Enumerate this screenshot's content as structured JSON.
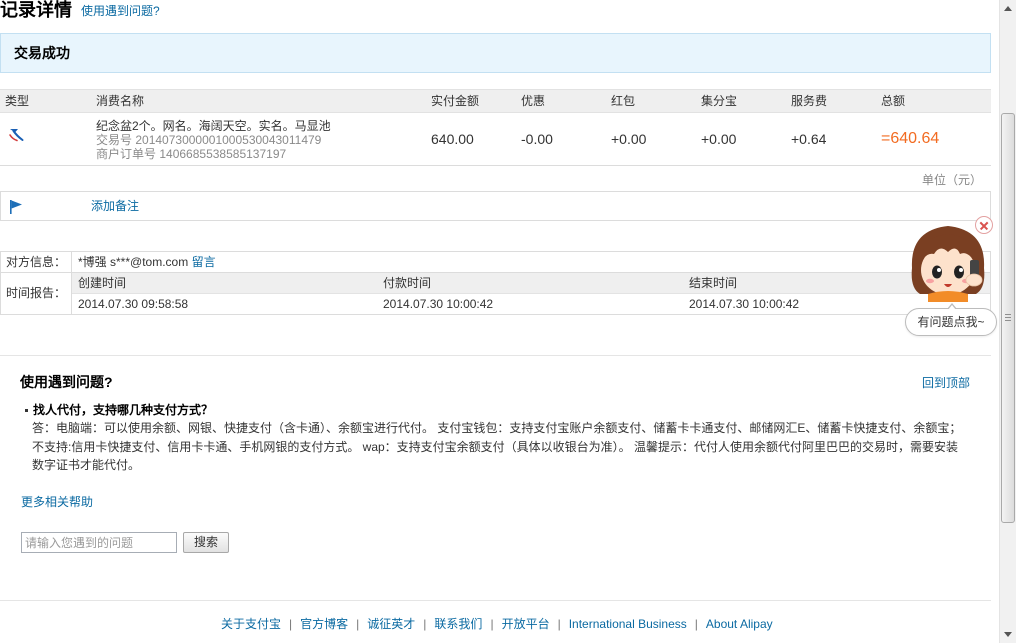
{
  "colors": {
    "link": "#0b6aa2",
    "total": "#f26b21",
    "status_bg": "#e8f5fd"
  },
  "header": {
    "title": "记录详情",
    "help_link": "使用遇到问题?"
  },
  "status": {
    "text": "交易成功"
  },
  "table": {
    "columns": [
      "类型",
      "消费名称",
      "实付金额",
      "优惠",
      "红包",
      "集分宝",
      "服务费",
      "总额"
    ],
    "rows": [
      {
        "type_icon": "transfer-icon",
        "name": "纪念盆2个。网名。海阔天空。实名。马显池",
        "trade_no_label": "交易号",
        "trade_no": "2014073000001000530043011479",
        "order_no_label": "商户订单号",
        "order_no": "1406685538585137197",
        "paid": "640.00",
        "discount": "-0.00",
        "red_packet": "+0.00",
        "jifenbao": "+0.00",
        "service_fee": "+0.64",
        "total": "=640.64"
      }
    ],
    "unit": "单位（元）"
  },
  "remark": {
    "icon": "flag-icon",
    "link": "添加备注"
  },
  "counterpart": {
    "label": "对方信息：",
    "name": "*博强",
    "email": "s***@tom.com",
    "message_link": "留言"
  },
  "time_report": {
    "label": "时间报告：",
    "columns": [
      "创建时间",
      "付款时间",
      "结束时间"
    ],
    "values": [
      "2014.07.30 09:58:58",
      "2014.07.30 10:00:42",
      "2014.07.30 10:00:42"
    ]
  },
  "assistant": {
    "bubble_text": "有问题点我~"
  },
  "help": {
    "title": "使用遇到问题?",
    "back_to_top": "回到顶部",
    "question": "找人代付，支持哪几种支付方式？",
    "answer_lines": [
      "答：电脑端：可以使用余额、网银、快捷支付（含卡通）、余额宝进行代付。 支付宝钱包：支持支付宝账户余额支付、储蓄卡卡通支付、邮储网汇E、储蓄卡快捷支付、余额宝；",
      "不支持:信用卡快捷支付、信用卡卡通、手机网银的支付方式。 wap：支持支付宝余额支付（具体以收银台为准）。 温馨提示：代付人使用余额代付阿里巴巴的交易时，需要安装",
      "数字证书才能代付。"
    ],
    "more_link": "更多相关帮助",
    "search_placeholder": "请输入您遇到的问题",
    "search_button": "搜索"
  },
  "footer": {
    "separator": "|",
    "links": [
      "关于支付宝",
      "官方博客",
      "诚征英才",
      "联系我们",
      "开放平台",
      "International Business",
      "About Alipay"
    ]
  }
}
